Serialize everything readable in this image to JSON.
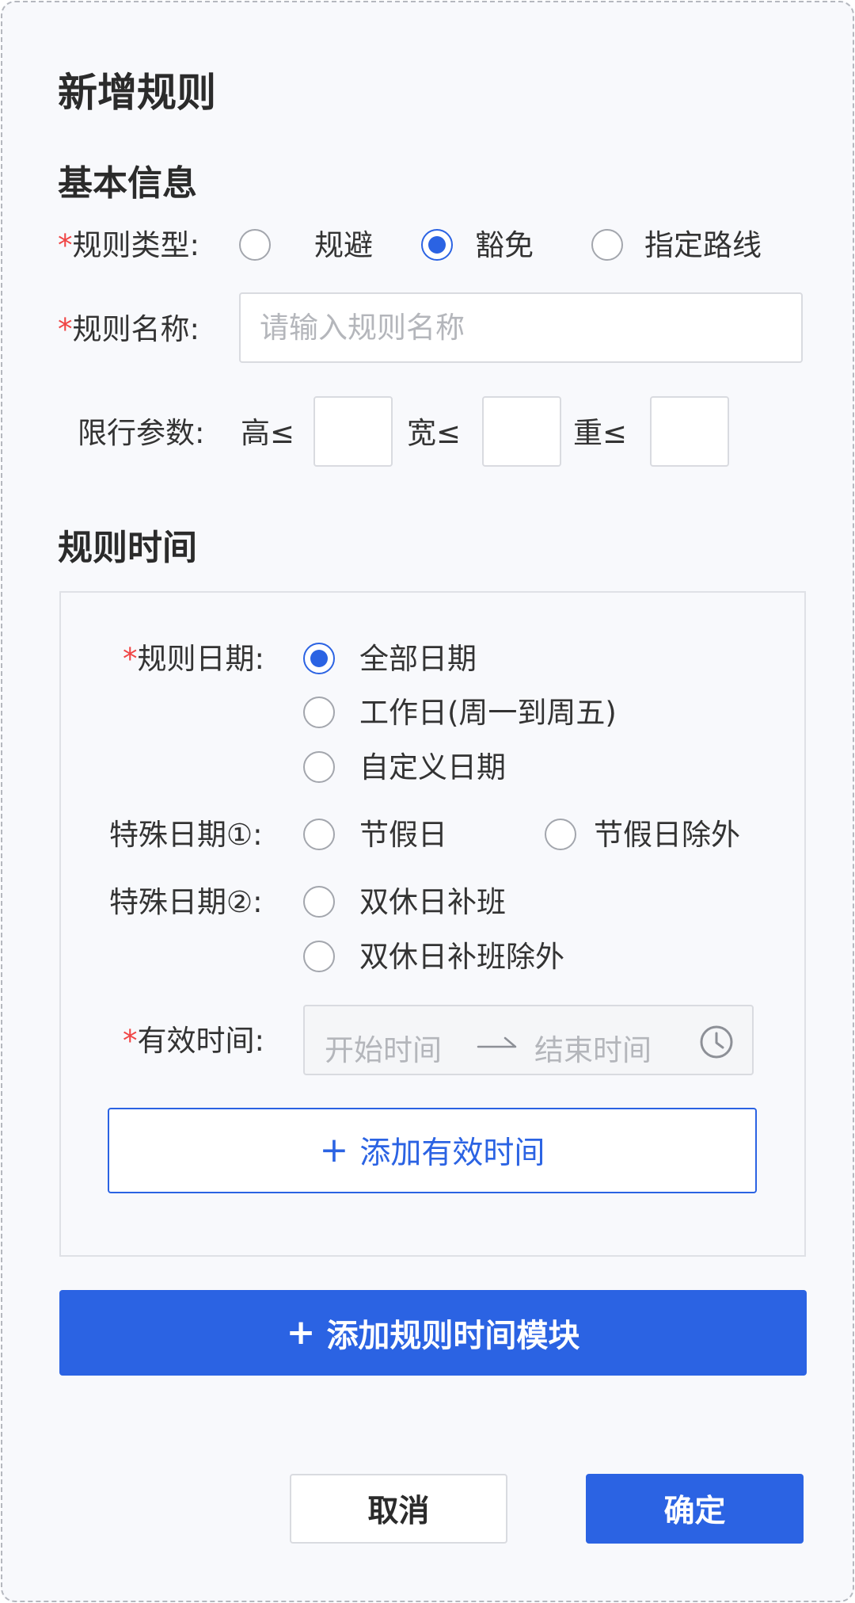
{
  "dialog": {
    "title": "新增规则"
  },
  "basic_info": {
    "heading": "基本信息",
    "rule_type": {
      "required_mark": "*",
      "label": "规则类型:",
      "options": [
        {
          "label": "规避",
          "checked": false
        },
        {
          "label": "豁免",
          "checked": true
        },
        {
          "label": "指定路线",
          "checked": false
        }
      ]
    },
    "rule_name": {
      "required_mark": "*",
      "label": "规则名称:",
      "value": "",
      "placeholder": "请输入规则名称"
    },
    "limit_params": {
      "label": "限行参数:",
      "height_label": "高≤",
      "height_value": "",
      "width_label": "宽≤",
      "width_value": "",
      "weight_label": "重≤",
      "weight_value": ""
    }
  },
  "rule_time": {
    "heading": "规则时间",
    "rule_date": {
      "required_mark": "*",
      "label": "规则日期:",
      "options": [
        {
          "label": "全部日期",
          "checked": true
        },
        {
          "label": "工作日(周一到周五)",
          "checked": false
        },
        {
          "label": "自定义日期",
          "checked": false
        }
      ]
    },
    "special_date_1": {
      "label": "特殊日期①:",
      "options": [
        {
          "label": "节假日",
          "checked": false
        },
        {
          "label": "节假日除外",
          "checked": false
        }
      ]
    },
    "special_date_2": {
      "label": "特殊日期②:",
      "options": [
        {
          "label": "双休日补班",
          "checked": false
        },
        {
          "label": "双休日补班除外",
          "checked": false
        }
      ]
    },
    "valid_time": {
      "required_mark": "*",
      "label": "有效时间:",
      "start_placeholder": "开始时间",
      "end_placeholder": "结束时间",
      "separator_icon": "long-arrow-right-icon",
      "clock_icon": "clock-icon"
    },
    "add_valid_time_label": "添加有效时间"
  },
  "add_time_module_label": "添加规则时间模块",
  "footer": {
    "cancel_label": "取消",
    "confirm_label": "确定"
  },
  "colors": {
    "primary": "#2b63e3",
    "required": "#f04646",
    "background": "#f8f9fc"
  }
}
